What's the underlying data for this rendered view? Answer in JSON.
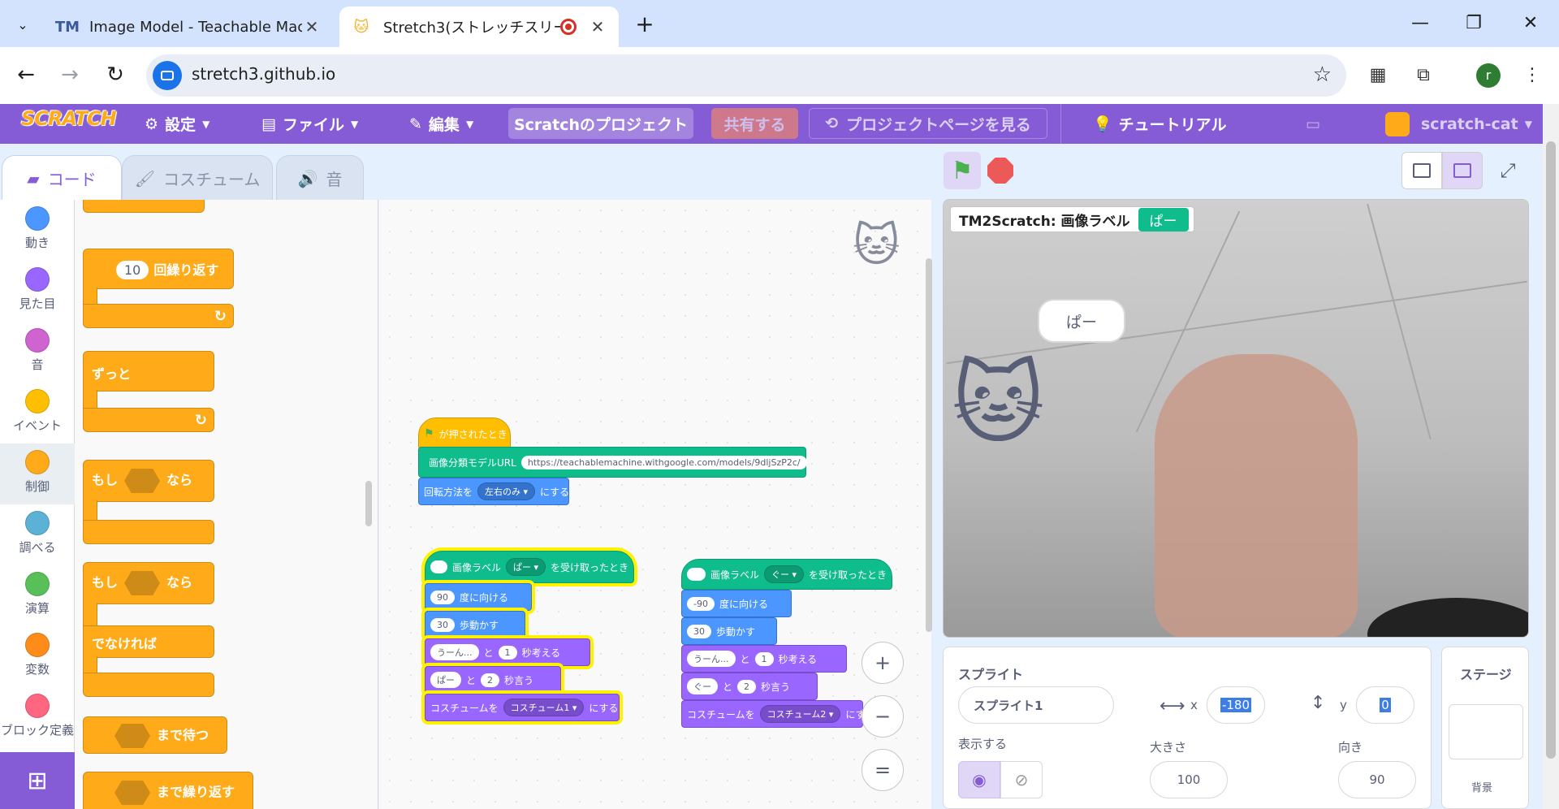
{
  "browser": {
    "tabs": [
      {
        "favicon": "TM",
        "title": "Image Model - Teachable Mach",
        "active": false
      },
      {
        "favicon": "cat-icon",
        "title": "Stretch3(ストレッチスリー)",
        "active": true
      }
    ],
    "url": "stretch3.github.io",
    "profile_initial": "r"
  },
  "menubar": {
    "logo": "SCRATCH",
    "settings": "設定",
    "file": "ファイル",
    "edit": "編集",
    "project_title": "Scratchのプロジェクト",
    "share": "共有する",
    "see_project_page": "プロジェクトページを見る",
    "tutorials": "チュートリアル",
    "username": "scratch-cat"
  },
  "editor_tabs": {
    "code": "コード",
    "costumes": "コスチューム",
    "sounds": "音"
  },
  "categories": [
    {
      "label": "動き",
      "color": "#4c97ff"
    },
    {
      "label": "見た目",
      "color": "#9966ff"
    },
    {
      "label": "音",
      "color": "#cf63cf"
    },
    {
      "label": "イベント",
      "color": "#ffbf00"
    },
    {
      "label": "制御",
      "color": "#ffab19",
      "selected": true
    },
    {
      "label": "調べる",
      "color": "#5cb1d6"
    },
    {
      "label": "演算",
      "color": "#59c059"
    },
    {
      "label": "変数",
      "color": "#ff8c1a"
    },
    {
      "label": "ブロック定義",
      "color": "#ff6680"
    }
  ],
  "palette": {
    "repeat_count": "10",
    "repeat": "回繰り返す",
    "forever": "ずっと",
    "if": "もし",
    "then": "なら",
    "else": "でなければ",
    "wait_until": "まで待つ",
    "repeat_until": "まで繰り返す"
  },
  "scripts": {
    "flag_hat": "が押されたとき",
    "model_url_label": "画像分類モデルURL",
    "model_url": "https://teachablemachine.withgoogle.com/models/9dljSzP2c/",
    "rotation_style": "回転方法を",
    "rotation_value": "左右のみ",
    "set_suffix": "にする",
    "scriptA": {
      "hat_label": "画像ラベル",
      "hat_value": "ぱー",
      "hat_suffix": "を受け取ったとき",
      "direction": "90",
      "direction_suffix": "度に向ける",
      "steps": "30",
      "steps_suffix": "歩動かす",
      "think_text": "うーん...",
      "and": "と",
      "think_secs": "1",
      "think_suffix": "秒考える",
      "say_text": "ぱー",
      "say_secs": "2",
      "say_suffix": "秒言う",
      "costume_label": "コスチュームを",
      "costume_value": "コスチューム1",
      "costume_suffix": "にする"
    },
    "scriptB": {
      "hat_label": "画像ラベル",
      "hat_value": "ぐー",
      "hat_suffix": "を受け取ったとき",
      "direction": "-90",
      "direction_suffix": "度に向ける",
      "steps": "30",
      "steps_suffix": "歩動かす",
      "think_text": "うーん...",
      "and": "と",
      "think_secs": "1",
      "think_suffix": "秒考える",
      "say_text": "ぐー",
      "say_secs": "2",
      "say_suffix": "秒言う",
      "costume_label": "コスチュームを",
      "costume_value": "コスチューム2",
      "costume_suffix": "にす"
    }
  },
  "zoom": {
    "in": "+",
    "out": "−",
    "reset": "="
  },
  "stage": {
    "monitor_label": "TM2Scratch: 画像ラベル",
    "monitor_value": "ぱー",
    "speech": "ぱー"
  },
  "sprite_info": {
    "heading": "スプライト",
    "name": "スプライト1",
    "x_label": "x",
    "x_value": "-180",
    "y_label": "y",
    "y_value": "0",
    "show_label": "表示する",
    "size_label": "大きさ",
    "size_value": "100",
    "direction_label": "向き",
    "direction_value": "90"
  },
  "stage_pane": {
    "heading": "ステージ",
    "backdrop_label": "背景"
  }
}
